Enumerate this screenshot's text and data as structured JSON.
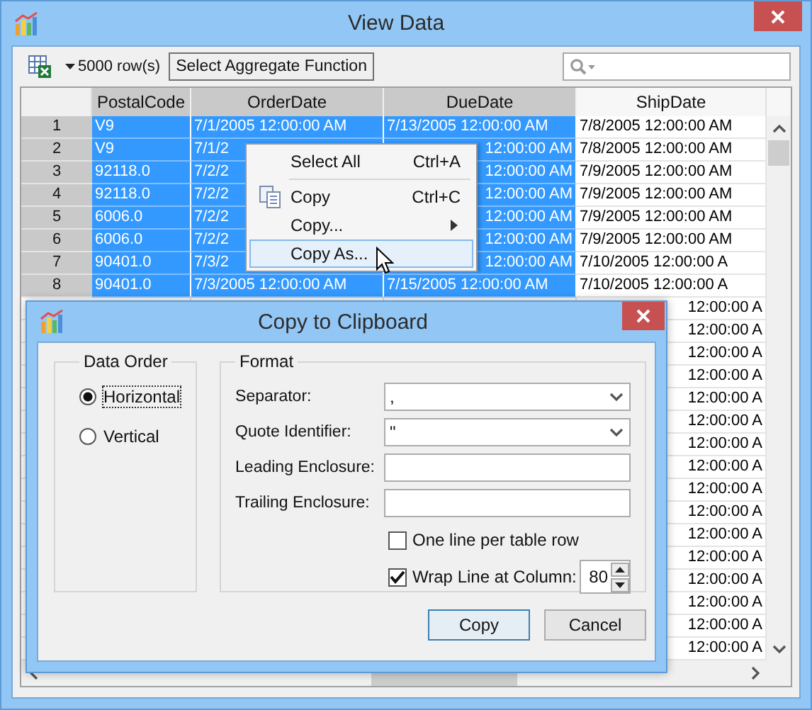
{
  "window": {
    "title": "View Data"
  },
  "toolbar": {
    "row_count": "5000 row(s)",
    "aggregate_button": "Select Aggregate Function"
  },
  "grid": {
    "columns": [
      {
        "label": "PostalCode",
        "selected": true
      },
      {
        "label": "OrderDate",
        "selected": true
      },
      {
        "label": "DueDate",
        "selected": true
      },
      {
        "label": "ShipDate",
        "selected": false
      }
    ],
    "rows": [
      {
        "kind": "full",
        "number": "1",
        "cells": [
          "V9",
          "7/1/2005 12:00:00 AM",
          "7/13/2005 12:00:00 AM",
          "7/8/2005 12:00:00 AM"
        ]
      },
      {
        "kind": "partial",
        "number": "2",
        "cells": [
          "V9",
          "7/1/2",
          "12:00:00 AM",
          "7/8/2005 12:00:00 AM"
        ]
      },
      {
        "kind": "partial",
        "number": "3",
        "cells": [
          "92118.0",
          "7/2/2",
          "12:00:00 AM",
          "7/9/2005 12:00:00 AM"
        ]
      },
      {
        "kind": "partial",
        "number": "4",
        "cells": [
          "92118.0",
          "7/2/2",
          "12:00:00 AM",
          "7/9/2005 12:00:00 AM"
        ]
      },
      {
        "kind": "partial",
        "number": "5",
        "cells": [
          "6006.0",
          "7/2/2",
          "12:00:00 AM",
          "7/9/2005 12:00:00 AM"
        ]
      },
      {
        "kind": "partial",
        "number": "6",
        "cells": [
          "6006.0",
          "7/2/2",
          "12:00:00 AM",
          "7/9/2005 12:00:00 AM"
        ]
      },
      {
        "kind": "partial",
        "number": "7",
        "cells": [
          "90401.0",
          "7/3/2",
          "12:00:00 AM",
          "7/10/2005 12:00:00 A"
        ]
      },
      {
        "kind": "full",
        "number": "8",
        "cells": [
          "90401.0",
          "7/3/2005 12:00:00 AM",
          "7/15/2005 12:00:00 AM",
          "7/10/2005 12:00:00 A"
        ]
      },
      {
        "kind": "covered",
        "cells": [
          "12:00:00 A"
        ]
      },
      {
        "kind": "covered",
        "cells": [
          "12:00:00 A"
        ]
      },
      {
        "kind": "covered",
        "cells": [
          "12:00:00 A"
        ]
      },
      {
        "kind": "covered",
        "cells": [
          "12:00:00 A"
        ]
      },
      {
        "kind": "covered",
        "cells": [
          "12:00:00 A"
        ]
      },
      {
        "kind": "covered",
        "cells": [
          "12:00:00 A"
        ]
      },
      {
        "kind": "covered",
        "cells": [
          "12:00:00 A"
        ]
      },
      {
        "kind": "covered",
        "cells": [
          "12:00:00 A"
        ]
      },
      {
        "kind": "covered",
        "cells": [
          "12:00:00 A"
        ]
      },
      {
        "kind": "covered",
        "cells": [
          "12:00:00 A"
        ]
      },
      {
        "kind": "covered",
        "cells": [
          "12:00:00 A"
        ]
      },
      {
        "kind": "covered",
        "cells": [
          "12:00:00 A"
        ]
      },
      {
        "kind": "covered",
        "cells": [
          "12:00:00 A"
        ]
      },
      {
        "kind": "covered",
        "cells": [
          "12:00:00 A"
        ]
      },
      {
        "kind": "covered",
        "cells": [
          "12:00:00 A"
        ]
      },
      {
        "kind": "covered",
        "cells": [
          "12:00:00 A"
        ]
      }
    ]
  },
  "context_menu": {
    "items": [
      {
        "kind": "item",
        "label": "Select All",
        "shortcut": "Ctrl+A",
        "selected": false
      },
      {
        "kind": "separator"
      },
      {
        "kind": "item_with_icon",
        "label": "Copy",
        "shortcut": "Ctrl+C",
        "selected": false
      },
      {
        "kind": "submenu",
        "label": "Copy...",
        "selected": false
      },
      {
        "kind": "item",
        "label": "Copy As...",
        "selected": true
      }
    ]
  },
  "dialog": {
    "title": "Copy to Clipboard",
    "data_order": {
      "label": "Data Order",
      "options": [
        {
          "label": "Horizontal",
          "selected": true,
          "focused": true
        },
        {
          "label": "Vertical",
          "selected": false,
          "focused": false
        }
      ]
    },
    "format": {
      "label": "Format",
      "fields": [
        {
          "kind": "dropdown",
          "label": "Separator:",
          "value": ","
        },
        {
          "kind": "dropdown",
          "label": "Quote Identifier:",
          "value": "\""
        },
        {
          "kind": "text",
          "label": "Leading Enclosure:"
        },
        {
          "kind": "text",
          "label": "Trailing Enclosure:"
        }
      ],
      "options": [
        {
          "kind": "checkbox",
          "label": "One line per table row",
          "checked": false
        },
        {
          "kind": "checkbox_spinner",
          "label": "Wrap Line at Column:",
          "checked": true,
          "value": "80"
        }
      ]
    },
    "buttons": [
      {
        "label": "Copy",
        "default": true
      },
      {
        "label": "Cancel",
        "default": false
      }
    ]
  }
}
